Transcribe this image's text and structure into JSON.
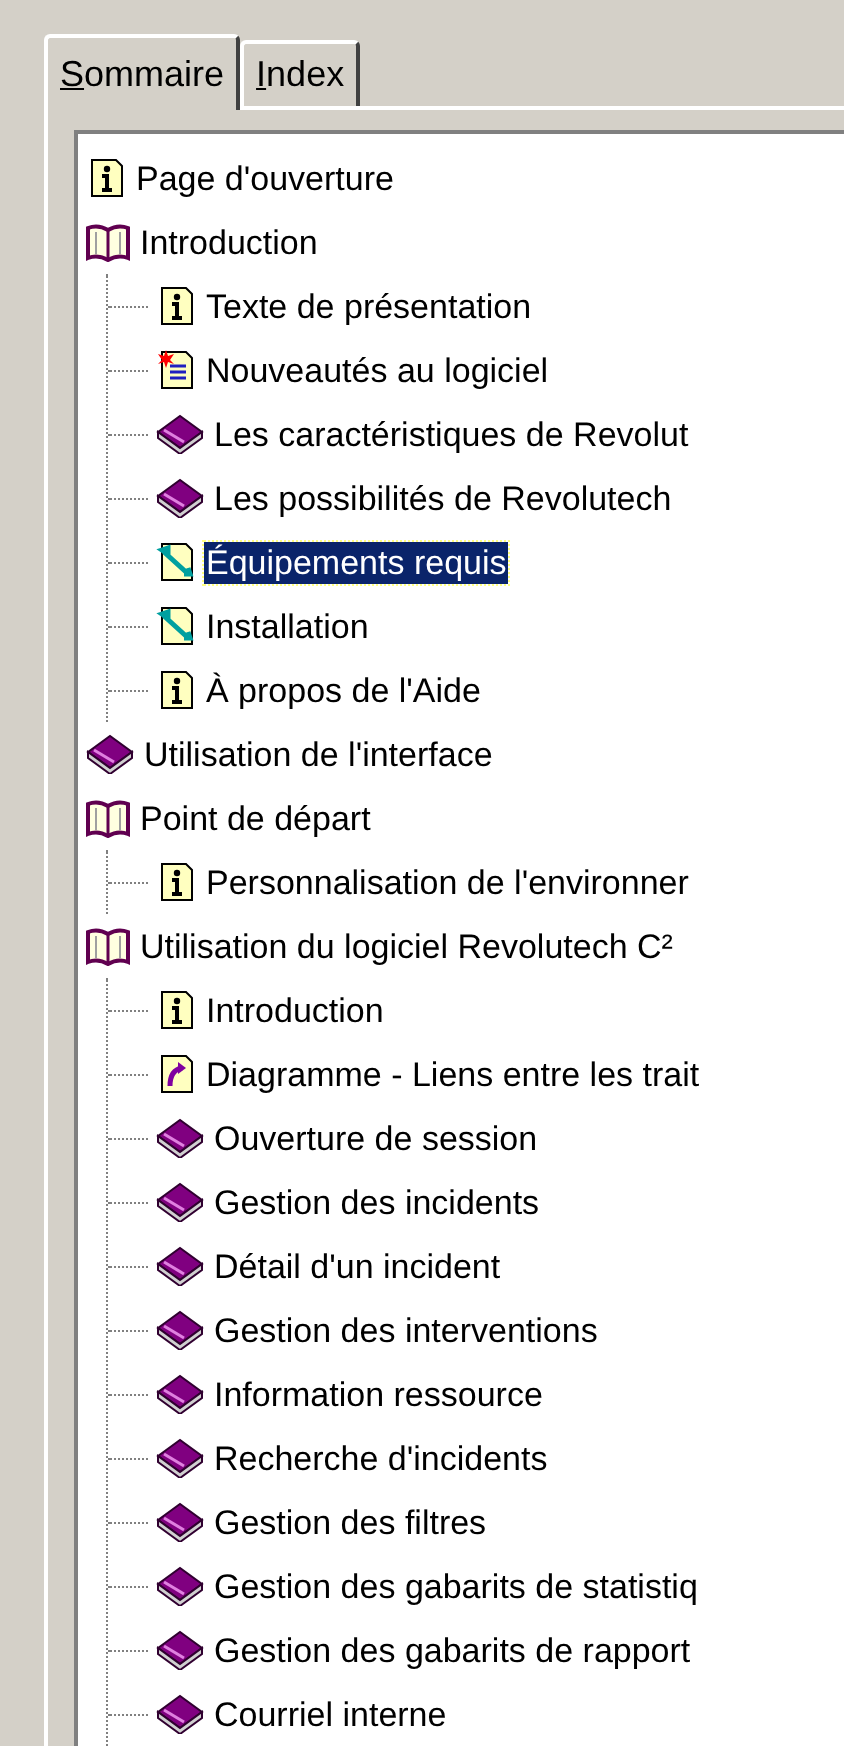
{
  "tabs": [
    {
      "label": "Sommaire",
      "selected": true
    },
    {
      "label": "Index",
      "selected": false
    }
  ],
  "tree": [
    {
      "label": "Page d'ouverture",
      "kind": "info",
      "selected": false
    },
    {
      "label": "Introduction",
      "kind": "book",
      "expanded": true,
      "selected": false,
      "children": [
        {
          "label": "Texte de présentation",
          "kind": "info",
          "selected": false
        },
        {
          "label": "Nouveautés au logiciel",
          "kind": "new",
          "selected": false
        },
        {
          "label": "Les caractéristiques de Revolut",
          "kind": "book",
          "expanded": false,
          "selected": false
        },
        {
          "label": "Les possibilités de Revolutech",
          "kind": "book",
          "expanded": false,
          "selected": false
        },
        {
          "label": "Équipements requis",
          "kind": "tool",
          "selected": true
        },
        {
          "label": "Installation",
          "kind": "tool",
          "selected": false
        },
        {
          "label": "À propos de l'Aide",
          "kind": "info",
          "selected": false
        }
      ]
    },
    {
      "label": "Utilisation de l'interface",
      "kind": "book",
      "expanded": false,
      "selected": false
    },
    {
      "label": "Point de départ",
      "kind": "book",
      "expanded": true,
      "selected": false,
      "children": [
        {
          "label": "Personnalisation de l'environner",
          "kind": "info",
          "selected": false
        }
      ]
    },
    {
      "label": "Utilisation du logiciel Revolutech C²",
      "kind": "book",
      "expanded": true,
      "selected": false,
      "children": [
        {
          "label": "Introduction",
          "kind": "info",
          "selected": false
        },
        {
          "label": "Diagramme - Liens entre les trait",
          "kind": "link",
          "selected": false
        },
        {
          "label": "Ouverture de session",
          "kind": "book",
          "expanded": false,
          "selected": false
        },
        {
          "label": "Gestion des incidents",
          "kind": "book",
          "expanded": false,
          "selected": false
        },
        {
          "label": "Détail d'un incident",
          "kind": "book",
          "expanded": false,
          "selected": false
        },
        {
          "label": "Gestion des interventions",
          "kind": "book",
          "expanded": false,
          "selected": false
        },
        {
          "label": "Information ressource",
          "kind": "book",
          "expanded": false,
          "selected": false
        },
        {
          "label": "Recherche d'incidents",
          "kind": "book",
          "expanded": false,
          "selected": false
        },
        {
          "label": "Gestion des filtres",
          "kind": "book",
          "expanded": false,
          "selected": false
        },
        {
          "label": "Gestion des gabarits de statistiq",
          "kind": "book",
          "expanded": false,
          "selected": false
        },
        {
          "label": "Gestion des gabarits de rapport",
          "kind": "book",
          "expanded": false,
          "selected": false
        },
        {
          "label": "Courriel interne",
          "kind": "book",
          "expanded": false,
          "selected": false
        }
      ]
    }
  ]
}
